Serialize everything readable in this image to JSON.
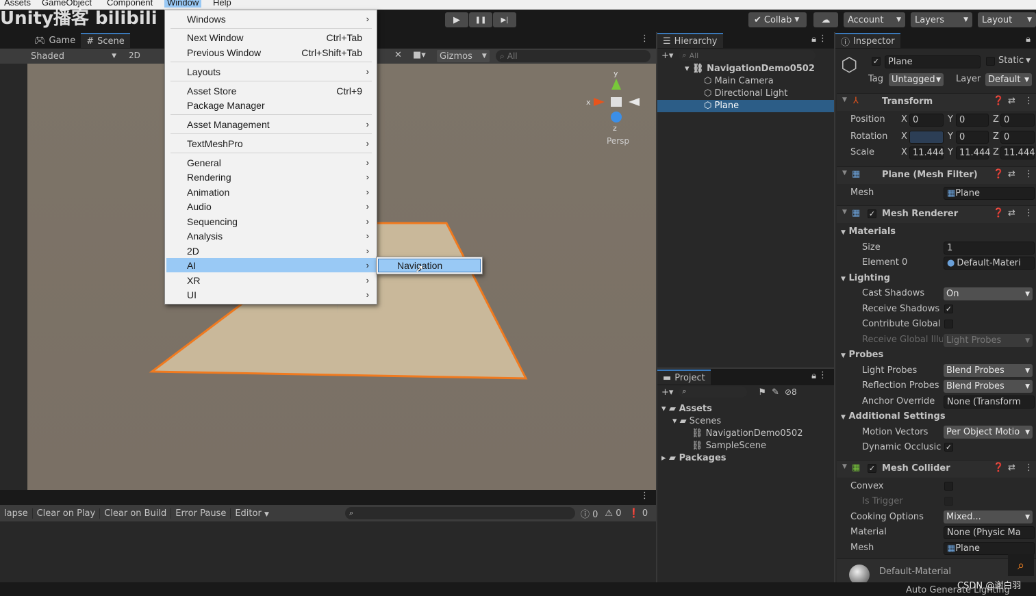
{
  "menubar": {
    "items": [
      "Assets",
      "GameObject",
      "Component",
      "Window",
      "Help"
    ]
  },
  "watermark": "Unity播客 bilibili",
  "toolbar": {
    "play": "▶",
    "pause": "❚❚",
    "step": "▶|",
    "collab": "Collab",
    "account": "Account",
    "layers": "Layers",
    "layout": "Layout"
  },
  "scene": {
    "tabs": [
      "Game",
      "Scene"
    ],
    "shading": "Shaded",
    "mode_2d": "2D",
    "gizmos": "Gizmos",
    "search_placeholder": "All",
    "persp": "Persp",
    "axis_x": "x",
    "axis_y": "y",
    "axis_z": "z"
  },
  "window_menu": {
    "items": [
      {
        "label": "Windows",
        "shortcut": "",
        "sub": true
      },
      {
        "label": "Next Window",
        "shortcut": "Ctrl+Tab",
        "sub": false
      },
      {
        "label": "Previous Window",
        "shortcut": "Ctrl+Shift+Tab",
        "sub": false
      },
      {
        "label": "Layouts",
        "shortcut": "",
        "sub": true
      },
      {
        "label": "Asset Store",
        "shortcut": "Ctrl+9",
        "sub": false
      },
      {
        "label": "Package Manager",
        "shortcut": "",
        "sub": false
      },
      {
        "label": "Asset Management",
        "shortcut": "",
        "sub": true
      },
      {
        "label": "TextMeshPro",
        "shortcut": "",
        "sub": true
      },
      {
        "label": "General",
        "shortcut": "",
        "sub": true
      },
      {
        "label": "Rendering",
        "shortcut": "",
        "sub": true
      },
      {
        "label": "Animation",
        "shortcut": "",
        "sub": true
      },
      {
        "label": "Audio",
        "shortcut": "",
        "sub": true
      },
      {
        "label": "Sequencing",
        "shortcut": "",
        "sub": true
      },
      {
        "label": "Analysis",
        "shortcut": "",
        "sub": true
      },
      {
        "label": "2D",
        "shortcut": "",
        "sub": true
      },
      {
        "label": "AI",
        "shortcut": "",
        "sub": true
      },
      {
        "label": "XR",
        "shortcut": "",
        "sub": true
      },
      {
        "label": "UI",
        "shortcut": "",
        "sub": true
      }
    ],
    "highlighted": "AI",
    "submenu_item": "Navigation"
  },
  "hierarchy": {
    "title": "Hierarchy",
    "search_placeholder": "All",
    "scene": "NavigationDemo0502",
    "children": [
      "Main Camera",
      "Directional Light",
      "Plane"
    ],
    "selected": "Plane"
  },
  "project": {
    "title": "Project",
    "badge": "8",
    "tree": [
      {
        "label": "Assets",
        "depth": 0,
        "kind": "folder"
      },
      {
        "label": "Scenes",
        "depth": 1,
        "kind": "folder"
      },
      {
        "label": "NavigationDemo0502",
        "depth": 2,
        "kind": "scene"
      },
      {
        "label": "SampleScene",
        "depth": 2,
        "kind": "scene"
      },
      {
        "label": "Packages",
        "depth": 0,
        "kind": "folder"
      }
    ]
  },
  "console": {
    "collapse": "lapse",
    "clear_on_play": "Clear on Play",
    "clear_on_build": "Clear on Build",
    "error_pause": "Error Pause",
    "editor": "Editor",
    "count_info": "0",
    "count_warn": "0",
    "count_error": "0"
  },
  "inspector": {
    "title": "Inspector",
    "object_name": "Plane",
    "static_label": "Static",
    "tag_label": "Tag",
    "tag_value": "Untagged",
    "layer_label": "Layer",
    "layer_value": "Default",
    "transform": {
      "title": "Transform",
      "position_label": "Position",
      "position": {
        "x": "0",
        "y": "0",
        "z": "0"
      },
      "rotation_label": "Rotation",
      "rotation": {
        "x": "",
        "y": "0",
        "z": "0"
      },
      "scale_label": "Scale",
      "scale": {
        "x": "11.444",
        "y": "11.444",
        "z": "11.444"
      }
    },
    "mesh_filter": {
      "title": "Plane (Mesh Filter)",
      "mesh_label": "Mesh",
      "mesh_value": "Plane"
    },
    "mesh_renderer": {
      "title": "Mesh Renderer",
      "materials": "Materials",
      "size_label": "Size",
      "size_value": "1",
      "element0_label": "Element 0",
      "element0_value": "Default-Materi",
      "lighting": "Lighting",
      "cast_shadows_label": "Cast Shadows",
      "cast_shadows_value": "On",
      "receive_shadows_label": "Receive Shadows",
      "contribute_gi_label": "Contribute Global",
      "receive_gi_label": "Receive Global Illu",
      "receive_gi_value": "Light Probes",
      "probes": "Probes",
      "light_probes_label": "Light Probes",
      "light_probes_value": "Blend Probes",
      "reflection_probes_label": "Reflection Probes",
      "reflection_probes_value": "Blend Probes",
      "anchor_override_label": "Anchor Override",
      "anchor_override_value": "None (Transform",
      "additional": "Additional Settings",
      "motion_vectors_label": "Motion Vectors",
      "motion_vectors_value": "Per Object Motio",
      "dynamic_occlusion_label": "Dynamic Occlusic"
    },
    "mesh_collider": {
      "title": "Mesh Collider",
      "convex_label": "Convex",
      "is_trigger_label": "Is Trigger",
      "cooking_label": "Cooking Options",
      "cooking_value": "Mixed...",
      "material_label": "Material",
      "material_value": "None (Physic Ma",
      "mesh_label": "Mesh",
      "mesh_value": "Plane"
    },
    "material_preview": "Default-Material",
    "auto_lighting": "Auto Generate Lighting"
  },
  "credit": "CSDN @谢白羽",
  "colors": {
    "accent": "#3a79bb",
    "menu_highlight": "#99c9f5",
    "selection": "#2c5d87",
    "plane_outline": "#f07a1f"
  }
}
